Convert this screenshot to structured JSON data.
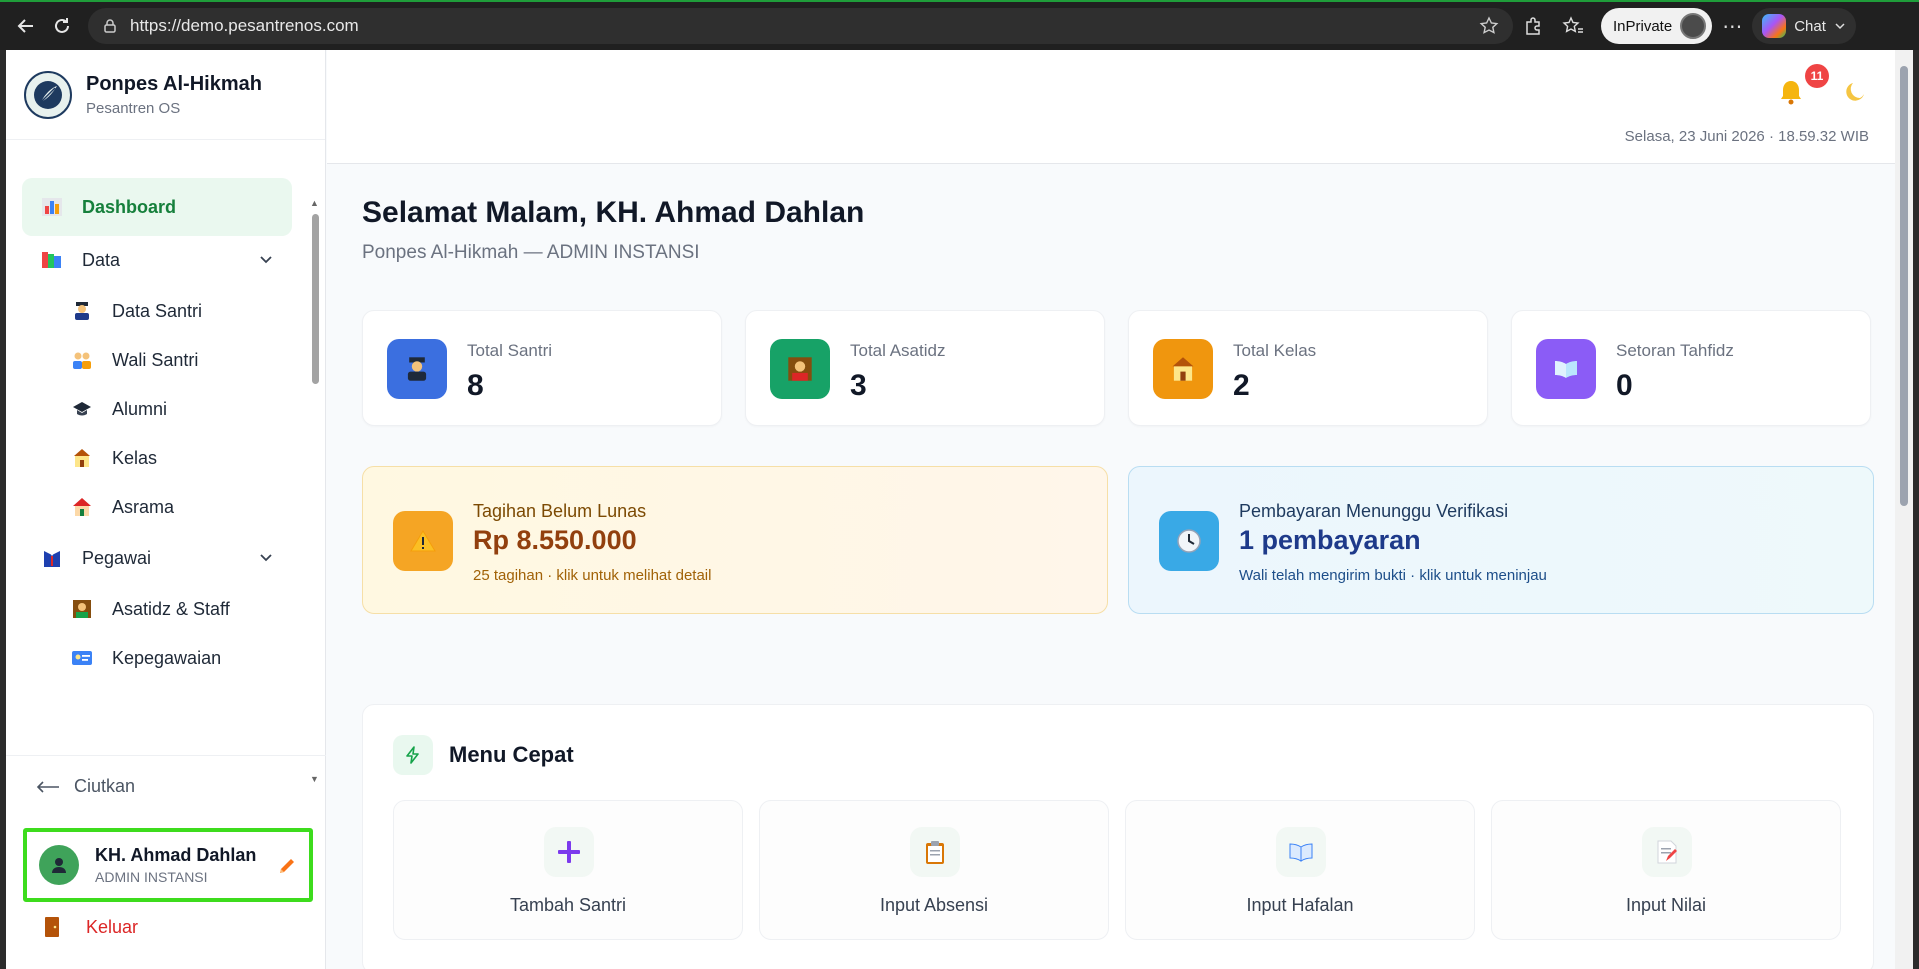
{
  "browser": {
    "url": "https://demo.pesantrenos.com",
    "inprivate_label": "InPrivate",
    "chat_label": "Chat"
  },
  "brand": {
    "name": "Ponpes Al-Hikmah",
    "subtitle": "Pesantren OS"
  },
  "sidebar": {
    "items": [
      {
        "label": "Dashboard",
        "icon": "bar-chart-icon"
      },
      {
        "label": "Data",
        "icon": "books-icon"
      },
      {
        "label": "Data Santri",
        "icon": "student-icon"
      },
      {
        "label": "Wali Santri",
        "icon": "family-icon"
      },
      {
        "label": "Alumni",
        "icon": "graduation-cap-icon"
      },
      {
        "label": "Kelas",
        "icon": "school-icon"
      },
      {
        "label": "Asrama",
        "icon": "house-icon"
      },
      {
        "label": "Pegawai",
        "icon": "suit-icon"
      },
      {
        "label": "Asatidz & Staff",
        "icon": "teacher-icon"
      },
      {
        "label": "Kepegawaian",
        "icon": "id-card-icon"
      }
    ],
    "collapse_label": "Ciutkan",
    "user": {
      "name": "KH. Ahmad Dahlan",
      "role": "ADMIN INSTANSI"
    },
    "logout_label": "Keluar"
  },
  "topbar": {
    "notification_count": "11",
    "datetime": "Selasa, 23 Juni 2026 · 18.59.32 WIB"
  },
  "main": {
    "greeting": "Selamat Malam, KH. Ahmad Dahlan",
    "subgreeting": "Ponpes Al-Hikmah — ADMIN INSTANSI",
    "stats": [
      {
        "label": "Total Santri",
        "value": "8",
        "color": "#3b6fe0"
      },
      {
        "label": "Total Asatidz",
        "value": "3",
        "color": "#17a267"
      },
      {
        "label": "Total Kelas",
        "value": "2",
        "color": "#f0960e"
      },
      {
        "label": "Setoran Tahfidz",
        "value": "0",
        "color": "#8b5cf6"
      }
    ],
    "alerts": {
      "unpaid": {
        "title": "Tagihan Belum Lunas",
        "value": "Rp 8.550.000",
        "note": "25 tagihan · klik untuk melihat detail"
      },
      "verify": {
        "title": "Pembayaran Menunggu Verifikasi",
        "value": "1 pembayaran",
        "note": "Wali telah mengirim bukti · klik untuk meninjau"
      }
    },
    "quick_menu": {
      "title": "Menu Cepat",
      "items": [
        {
          "label": "Tambah Santri",
          "icon": "plus-icon"
        },
        {
          "label": "Input Absensi",
          "icon": "clipboard-icon"
        },
        {
          "label": "Input Hafalan",
          "icon": "open-book-icon"
        },
        {
          "label": "Input Nilai",
          "icon": "memo-icon"
        }
      ]
    }
  }
}
